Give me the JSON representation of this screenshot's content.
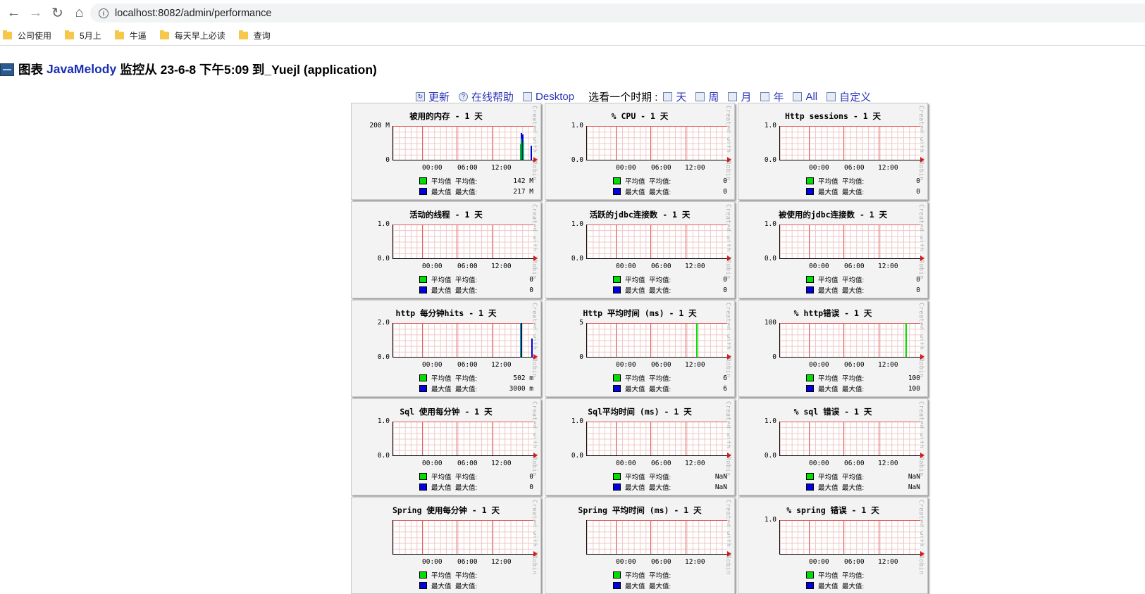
{
  "browser": {
    "url": "localhost:8082/admin/performance",
    "bookmarks": [
      "公司使用",
      "5月上",
      "牛逼",
      "每天早上必读",
      "查询"
    ]
  },
  "header": {
    "prefix": "图表",
    "app": "JavaMelody",
    "suffix": "监控从 23-6-8 下午5:09 到_Yuejl (application)"
  },
  "toolbar": {
    "refresh": "更新",
    "help": "在线帮助",
    "desktop": "Desktop",
    "period_label": "选看一个时期 :",
    "periods": [
      "天",
      "周",
      "月",
      "年",
      "All",
      "自定义"
    ]
  },
  "legend_labels": {
    "mean_name": "平均值",
    "mean_stat": "平均值:",
    "max_name": "最大值",
    "max_stat": "最大值:"
  },
  "colors": {
    "mean": "#00e000",
    "max": "#0000e0"
  },
  "x_ticks": [
    "00:00",
    "06:00",
    "12:00"
  ],
  "watermark": "Created with JRobin",
  "charts": [
    {
      "title": "被用的内存 - 1 天",
      "ymin": "0",
      "ymax": "200 M",
      "mean": "142 M",
      "max": "217 M"
    },
    {
      "title": "% CPU - 1 天",
      "ymin": "0.0",
      "ymax": "1.0",
      "mean": "0",
      "max": "0"
    },
    {
      "title": "Http sessions - 1 天",
      "ymin": "0.0",
      "ymax": "1.0",
      "mean": "0",
      "max": "0"
    },
    {
      "title": "活动的线程 - 1 天",
      "ymin": "0.0",
      "ymax": "1.0",
      "mean": "0",
      "max": "0"
    },
    {
      "title": "活跃的jdbc连接数 - 1 天",
      "ymin": "0.0",
      "ymax": "1.0",
      "mean": "0",
      "max": "0"
    },
    {
      "title": "被使用的jdbc连接数 - 1 天",
      "ymin": "0.0",
      "ymax": "1.0",
      "mean": "0",
      "max": "0"
    },
    {
      "title": "http 每分钟hits - 1 天",
      "ymin": "0.0",
      "ymax": "2.0",
      "mean": "502 m",
      "max": "3000 m"
    },
    {
      "title": "Http 平均时间 (ms) - 1 天",
      "ymin": "0",
      "ymax": "5",
      "mean": "6",
      "max": "6"
    },
    {
      "title": "% http错误 - 1 天",
      "ymin": "0",
      "ymax": "100",
      "mean": "100",
      "max": "100"
    },
    {
      "title": "Sql 使用每分钟 - 1 天",
      "ymin": "0.0",
      "ymax": "1.0",
      "mean": "0",
      "max": "0"
    },
    {
      "title": "Sql平均时间 (ms) - 1 天",
      "ymin": "0.0",
      "ymax": "1.0",
      "mean": "NaN",
      "max": "NaN"
    },
    {
      "title": "% sql 错误 - 1 天",
      "ymin": "0.0",
      "ymax": "1.0",
      "mean": "NaN",
      "max": "NaN"
    },
    {
      "title": "Spring 使用每分钟 - 1 天",
      "ymin": "",
      "ymax": "",
      "mean": "",
      "max": ""
    },
    {
      "title": "Spring 平均时间 (ms) - 1 天",
      "ymin": "",
      "ymax": "",
      "mean": "",
      "max": ""
    },
    {
      "title": "% spring 错误 - 1 天",
      "ymin": "",
      "ymax": "1.0",
      "mean": "",
      "max": ""
    }
  ]
}
